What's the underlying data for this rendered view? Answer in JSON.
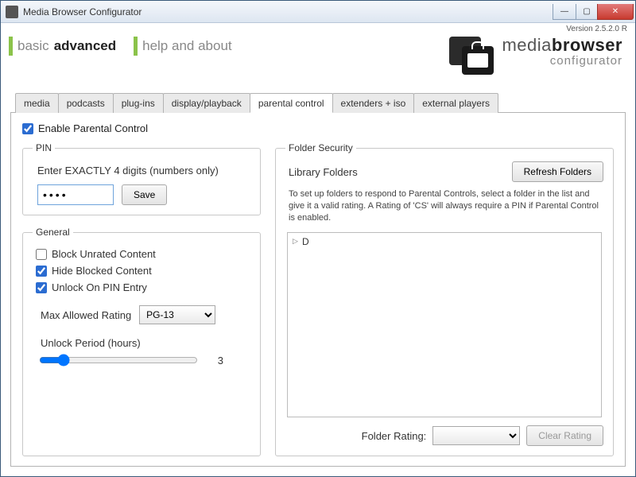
{
  "window": {
    "title": "Media Browser Configurator"
  },
  "version_label": "Version 2.5.2.0 R",
  "nav": {
    "basic": "basic",
    "advanced": "advanced",
    "help": "help and about"
  },
  "brand": {
    "name_light": "media",
    "name_bold": "browser",
    "sub": "configurator"
  },
  "tabs": [
    {
      "label": "media"
    },
    {
      "label": "podcasts"
    },
    {
      "label": "plug-ins"
    },
    {
      "label": "display/playback"
    },
    {
      "label": "parental control",
      "active": true
    },
    {
      "label": "extenders + iso"
    },
    {
      "label": "external players"
    }
  ],
  "enable": {
    "label": "Enable Parental Control",
    "checked": true
  },
  "pin": {
    "legend": "PIN",
    "label": "Enter EXACTLY 4 digits (numbers only)",
    "value": "••••",
    "save": "Save"
  },
  "general": {
    "legend": "General",
    "block_unrated": {
      "label": "Block Unrated Content",
      "checked": false
    },
    "hide_blocked": {
      "label": "Hide Blocked Content",
      "checked": true
    },
    "unlock_on_pin": {
      "label": "Unlock On PIN Entry",
      "checked": true
    },
    "max_rating_label": "Max Allowed Rating",
    "max_rating_value": "PG-13",
    "unlock_period_label": "Unlock Period (hours)",
    "unlock_period_value": "3"
  },
  "folder_security": {
    "legend": "Folder Security",
    "subtitle": "Library Folders",
    "refresh": "Refresh Folders",
    "description": "To set up folders to respond to Parental Controls, select a folder in the list and give it a valid rating.  A Rating of 'CS' will always require a PIN if Parental Control is enabled.",
    "tree_root": "D",
    "rating_label": "Folder Rating:",
    "rating_value": "",
    "clear": "Clear Rating"
  }
}
